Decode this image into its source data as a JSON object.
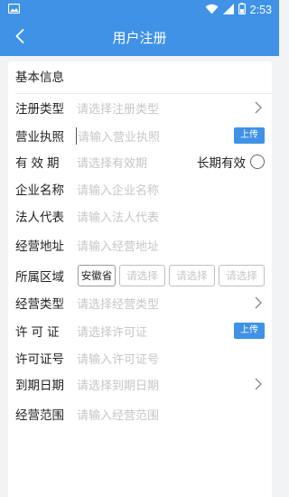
{
  "status_bar": {
    "time": "2:53"
  },
  "app_bar": {
    "title": "用户注册"
  },
  "section": {
    "title": "基本信息"
  },
  "form": {
    "reg_type": {
      "label": "注册类型",
      "placeholder": "请选择注册类型"
    },
    "license": {
      "label": "营业执照",
      "placeholder": "请输入营业执照",
      "upload": "上传"
    },
    "validity": {
      "label": "有效期",
      "placeholder": "请选择有效期",
      "longterm": "长期有效"
    },
    "company": {
      "label": "企业名称",
      "placeholder": "请输入企业名称"
    },
    "legal_rep": {
      "label": "法人代表",
      "placeholder": "请输入法人代表"
    },
    "address": {
      "label": "经营地址",
      "placeholder": "请输入经营地址"
    },
    "region": {
      "label": "所属区域",
      "province": "安徽省",
      "select1": "请选择",
      "select2": "请选择",
      "select3": "请选择"
    },
    "biz_type": {
      "label": "经营类型",
      "placeholder": "请选择经营类型"
    },
    "permit": {
      "label": "许可证",
      "placeholder": "请选择许可证",
      "upload": "上传"
    },
    "permit_no": {
      "label": "许可证号",
      "placeholder": "请输入许可证号"
    },
    "expiry": {
      "label": "到期日期",
      "placeholder": "请选择到期日期"
    },
    "scope": {
      "label": "经营范围",
      "placeholder": "请输入经营范围"
    }
  },
  "icons": {
    "image": "image-icon",
    "wifi": "wifi-icon",
    "signal": "signal-icon",
    "battery": "battery-icon",
    "back": "back-arrow-icon",
    "chevron": "chevron-right-icon"
  }
}
